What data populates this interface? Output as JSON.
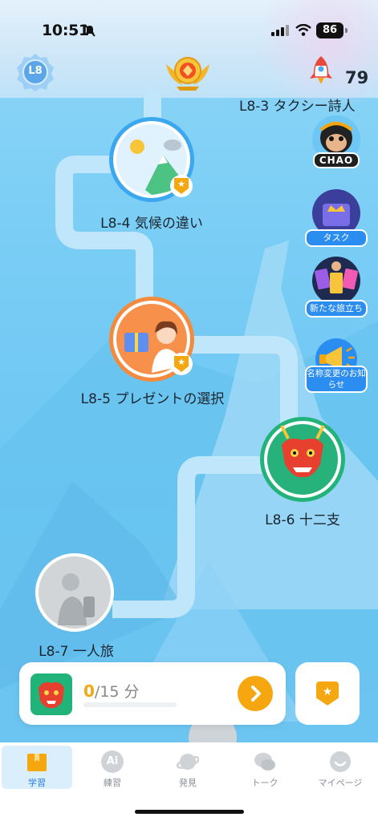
{
  "status_bar": {
    "time": "10:51",
    "battery": "86"
  },
  "header": {
    "level_badge": "L8",
    "points": "79"
  },
  "lessons": [
    {
      "id": "l3",
      "label": "L8-3 タクシー詩人"
    },
    {
      "id": "l4",
      "label": "L8-4 気候の違い"
    },
    {
      "id": "l5",
      "label": "L8-5 プレゼントの選択"
    },
    {
      "id": "l6",
      "label": "L8-6 十二支"
    },
    {
      "id": "l7",
      "label": "L8-7 一人旅"
    }
  ],
  "side_buttons": {
    "chao": "CHAO",
    "task": "タスク",
    "journey": "新たな旅立ち",
    "rename": "名称変更のお知らせ"
  },
  "progress_card": {
    "done": "0",
    "total": "/15 分",
    "progress_fraction": 0.0
  },
  "tabs": [
    {
      "label": "学習",
      "active": true
    },
    {
      "label": "練習",
      "icon_text": "Ai"
    },
    {
      "label": "発見"
    },
    {
      "label": "トーク"
    },
    {
      "label": "マイページ"
    }
  ],
  "colors": {
    "accent": "#f6a60f",
    "primary_blue": "#2b8df0",
    "sky": "#79cdf5",
    "dragon_green": "#22b37a"
  }
}
